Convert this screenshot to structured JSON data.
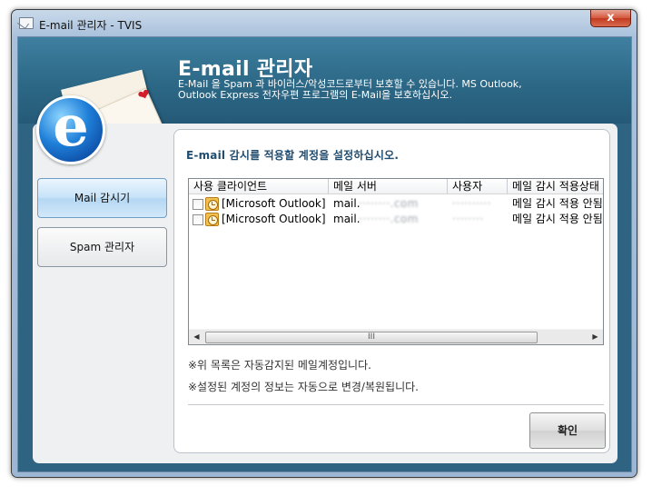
{
  "window": {
    "title": "E-mail 관리자 - TVIS",
    "close_label": "x"
  },
  "banner": {
    "title": "E-mail 관리자",
    "description": "E-Mail 을 Spam 과 바이러스/악성코드로부터 보호할 수 있습니다. MS Outlook, Outlook Express 전자우편 프로그램의 E-Mail을 보호하십시오."
  },
  "sidebar": {
    "items": [
      {
        "label": "Mail 감시기",
        "active": true
      },
      {
        "label": "Spam 관리자",
        "active": false
      }
    ]
  },
  "panel": {
    "heading": "E-mail 감시를 적용할 계정을 설정하십시오.",
    "columns": [
      "사용 클라이언트",
      "메일 서버",
      "사용자",
      "메일 감시 적용상태"
    ],
    "rows": [
      {
        "checked": false,
        "client": "[Microsoft Outlook]",
        "server_prefix": "mail.",
        "server_blurred": "········.com",
        "user_blurred": "··········",
        "status": "메일 감시 적용 안됨"
      },
      {
        "checked": false,
        "client": "[Microsoft Outlook]",
        "server_prefix": "mail.",
        "server_blurred": "········.com",
        "user_blurred": "········",
        "status": "메일 감시 적용 안됨"
      }
    ],
    "scroll_thumb_label": "III",
    "notes": [
      "※위 목록은 자동감지된 메일계정입니다.",
      "※설정된 계정의 정보는 자동으로 변경/복원됩니다."
    ],
    "ok_label": "확인"
  }
}
